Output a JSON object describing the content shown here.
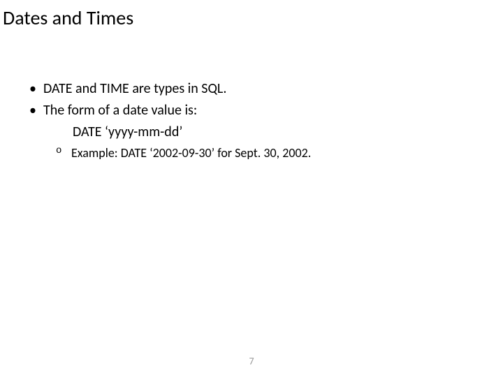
{
  "title": "Dates and Times",
  "bullets": {
    "b1": "DATE and TIME are types in SQL.",
    "b2": "The form of a date value is:",
    "b2_line": "DATE ‘yyyy-mm-dd’",
    "sub1": "Example: DATE ‘2002-09-30’ for Sept. 30, 2002."
  },
  "page_number": "7"
}
